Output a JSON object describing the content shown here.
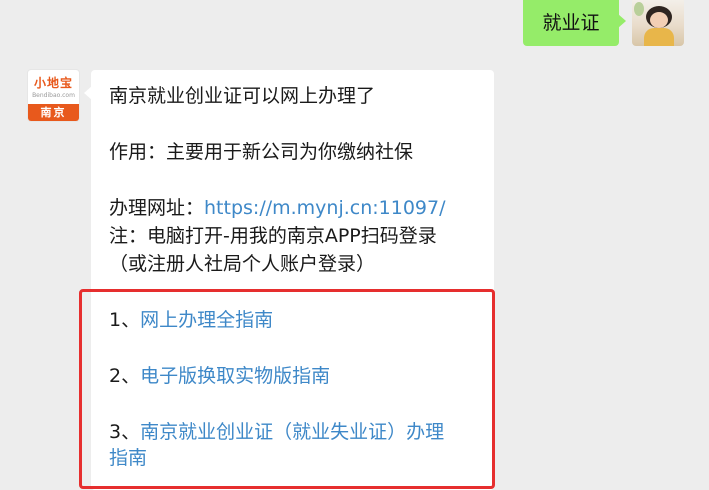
{
  "outgoing_message": {
    "text": "就业证"
  },
  "bot": {
    "logo_text": "小地宝",
    "logo_subtext": "Bendibao.com",
    "city": "南京"
  },
  "incoming_message": {
    "title": "南京就业创业证可以网上办理了",
    "purpose": "作用：主要用于新公司为你缴纳社保",
    "site_label": "办理网址：",
    "site_url": "https://m.mynj.cn:11097/",
    "note_line1": "注：电脑打开-用我的南京APP扫码登录",
    "note_line2": "（或注册人社局个人账户登录）",
    "links": [
      {
        "num": "1、",
        "label": "网上办理全指南"
      },
      {
        "num": "2、",
        "label": "电子版换取实物版指南"
      },
      {
        "num": "3、",
        "label": "南京就业创业证（就业失业证）办理"
      }
    ],
    "link3_cont": "指南"
  },
  "colors": {
    "link": "#3e88c8",
    "highlight_border": "#e62e2e",
    "outgoing_bubble": "#95ec69",
    "bot_brand": "#e8591c"
  }
}
